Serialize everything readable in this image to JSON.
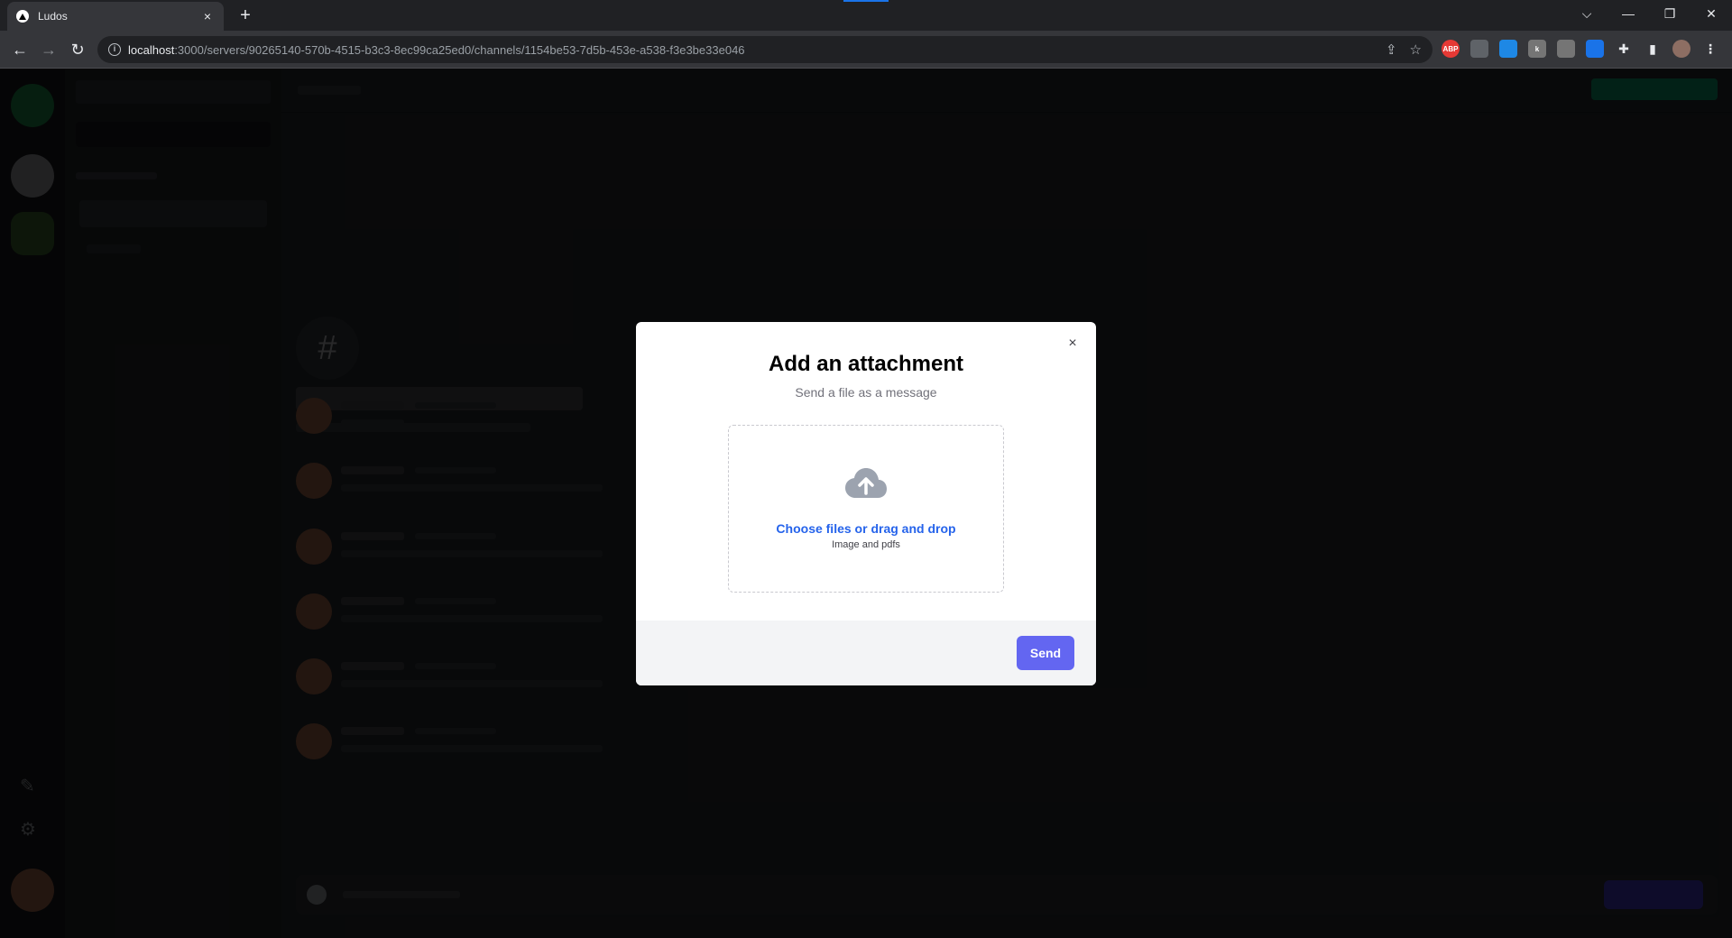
{
  "browser": {
    "tab_title": "Ludos",
    "tab_close": "×",
    "new_tab": "+",
    "url_host": "localhost",
    "url_rest": ":3000/servers/90265140-570b-4515-b3c3-8ec99ca25ed0/channels/1154be53-7d5b-453e-a538-f3e3be33e046",
    "extensions": [
      {
        "name": "adblock-plus-icon",
        "label": "ABP",
        "color": "#e53935"
      },
      {
        "name": "bulb-icon",
        "label": "",
        "color": "#5f6368"
      },
      {
        "name": "react-devtools-icon",
        "label": "",
        "color": "#1e88e5"
      },
      {
        "name": "extension-k-icon",
        "label": "k",
        "color": "#757575"
      },
      {
        "name": "extension-lightning-icon",
        "label": "",
        "color": "#757575"
      },
      {
        "name": "extension-blue-icon",
        "label": "",
        "color": "#1a73e8"
      }
    ]
  },
  "modal": {
    "title": "Add an attachment",
    "subtitle": "Send a file as a message",
    "dropzone_label": "Choose files or drag and drop",
    "dropzone_hint": "Image and pdfs",
    "send_label": "Send",
    "close_glyph": "×"
  },
  "colors": {
    "accent": "#6366f1",
    "link": "#2563eb"
  }
}
